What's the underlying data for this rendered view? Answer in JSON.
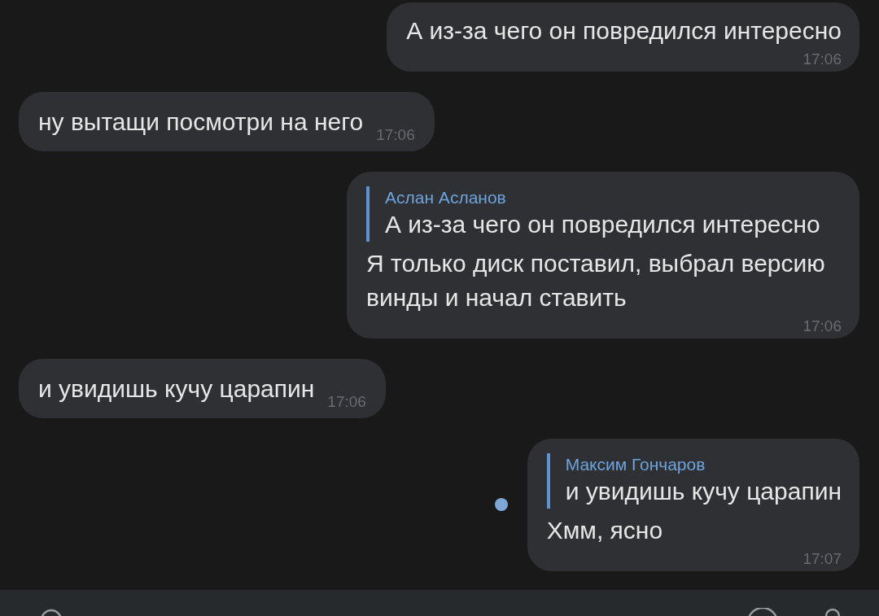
{
  "messages": [
    {
      "kind": "outgoing",
      "text": "А из-за чего он повредился интересно",
      "time": "17:06",
      "unread": false
    },
    {
      "kind": "incoming",
      "text": "ну вытащи посмотри на него",
      "time": "17:06",
      "unread": false
    },
    {
      "kind": "outgoing",
      "reply": {
        "author": "Аслан Асланов",
        "text": "А из-за чего он повредился интересно"
      },
      "text": "Я только диск поставил, выбрал версию винды и начал ставить",
      "time": "17:06",
      "unread": false
    },
    {
      "kind": "incoming",
      "text": "и увидишь кучу царапин",
      "time": "17:06",
      "unread": false
    },
    {
      "kind": "outgoing",
      "reply": {
        "author": "Максим Гончаров",
        "text": "и увидишь кучу царапин"
      },
      "text": "Хмм, ясно",
      "time": "17:07",
      "unread": true
    }
  ]
}
